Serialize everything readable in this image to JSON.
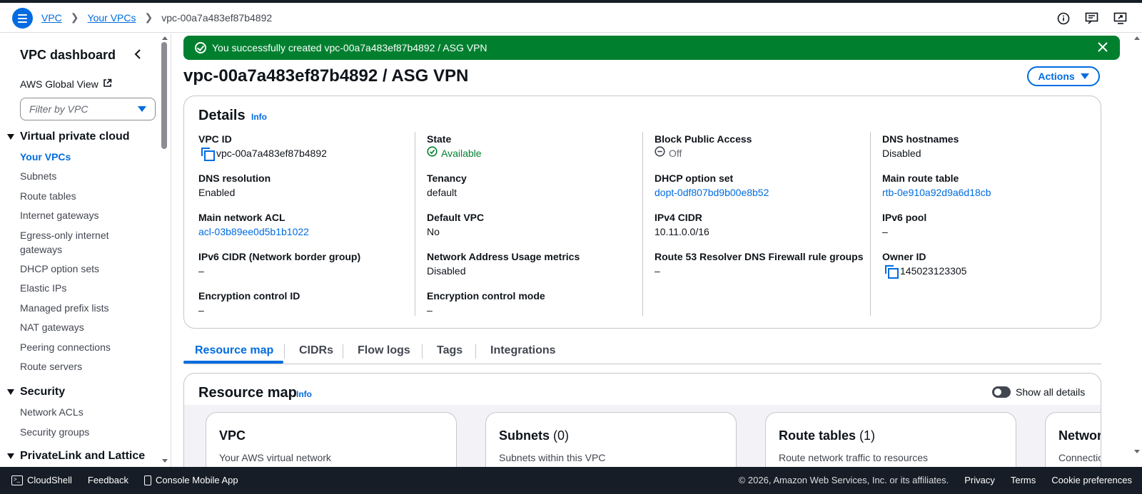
{
  "breadcrumb": [
    "VPC",
    "Your VPCs",
    "vpc-00a7a483ef87b4892"
  ],
  "sidebar": {
    "title": "VPC dashboard",
    "global_view": "AWS Global View",
    "filter_placeholder": "Filter by VPC",
    "sections": [
      {
        "label": "Virtual private cloud",
        "items": [
          "Your VPCs",
          "Subnets",
          "Route tables",
          "Internet gateways",
          "Egress-only internet gateways",
          "DHCP option sets",
          "Elastic IPs",
          "Managed prefix lists",
          "NAT gateways",
          "Peering connections",
          "Route servers"
        ]
      },
      {
        "label": "Security",
        "items": [
          "Network ACLs",
          "Security groups"
        ]
      },
      {
        "label": "PrivateLink and Lattice",
        "items": []
      }
    ]
  },
  "flash": {
    "message": "You successfully created vpc-00a7a483ef87b4892 / ASG VPN"
  },
  "page_title": "vpc-00a7a483ef87b4892 / ASG VPN",
  "actions_label": "Actions",
  "details": {
    "title": "Details",
    "info": "Info",
    "fields": {
      "vpc_id": {
        "k": "VPC ID",
        "v": "vpc-00a7a483ef87b4892"
      },
      "dns_resolution": {
        "k": "DNS resolution",
        "v": "Enabled"
      },
      "main_acl": {
        "k": "Main network ACL",
        "v": "acl-03b89ee0d5b1b1022"
      },
      "ipv6_cidr": {
        "k": "IPv6 CIDR (Network border group)",
        "v": "–"
      },
      "enc_id": {
        "k": "Encryption control ID",
        "v": "–"
      },
      "state": {
        "k": "State",
        "v": "Available"
      },
      "tenancy": {
        "k": "Tenancy",
        "v": "default"
      },
      "default_vpc": {
        "k": "Default VPC",
        "v": "No"
      },
      "nau_metrics": {
        "k": "Network Address Usage metrics",
        "v": "Disabled"
      },
      "enc_mode": {
        "k": "Encryption control mode",
        "v": "–"
      },
      "bpa": {
        "k": "Block Public Access",
        "v": "Off"
      },
      "dhcp": {
        "k": "DHCP option set",
        "v": "dopt-0df807bd9b00e8b52"
      },
      "ipv4_cidr": {
        "k": "IPv4 CIDR",
        "v": "10.11.0.0/16"
      },
      "r53": {
        "k": "Route 53 Resolver DNS Firewall rule groups",
        "v": "–"
      },
      "dns_hostnames": {
        "k": "DNS hostnames",
        "v": "Disabled"
      },
      "main_rt": {
        "k": "Main route table",
        "v": "rtb-0e910a92d9a6d18cb"
      },
      "ipv6_pool": {
        "k": "IPv6 pool",
        "v": "–"
      },
      "owner": {
        "k": "Owner ID",
        "v": "145023123305"
      }
    }
  },
  "tabs": [
    "Resource map",
    "CIDRs",
    "Flow logs",
    "Tags",
    "Integrations"
  ],
  "resource_map": {
    "title": "Resource map",
    "info": "Info",
    "toggle_label": "Show all details",
    "cards": [
      {
        "title": "VPC",
        "count": "",
        "desc": "Your AWS virtual network"
      },
      {
        "title": "Subnets",
        "count": "(0)",
        "desc": "Subnets within this VPC"
      },
      {
        "title": "Route tables",
        "count": "(1)",
        "desc": "Route network traffic to resources"
      },
      {
        "title": "Network",
        "count": "",
        "desc": "Connections"
      }
    ]
  },
  "footer": {
    "cloudshell": "CloudShell",
    "feedback": "Feedback",
    "mobile": "Console Mobile App",
    "copyright": "© 2026, Amazon Web Services, Inc. or its affiliates.",
    "privacy": "Privacy",
    "terms": "Terms",
    "cookies": "Cookie preferences"
  },
  "colors": {
    "accent": "#006ce0",
    "success": "#00802f",
    "footer_bg": "#161d26"
  }
}
